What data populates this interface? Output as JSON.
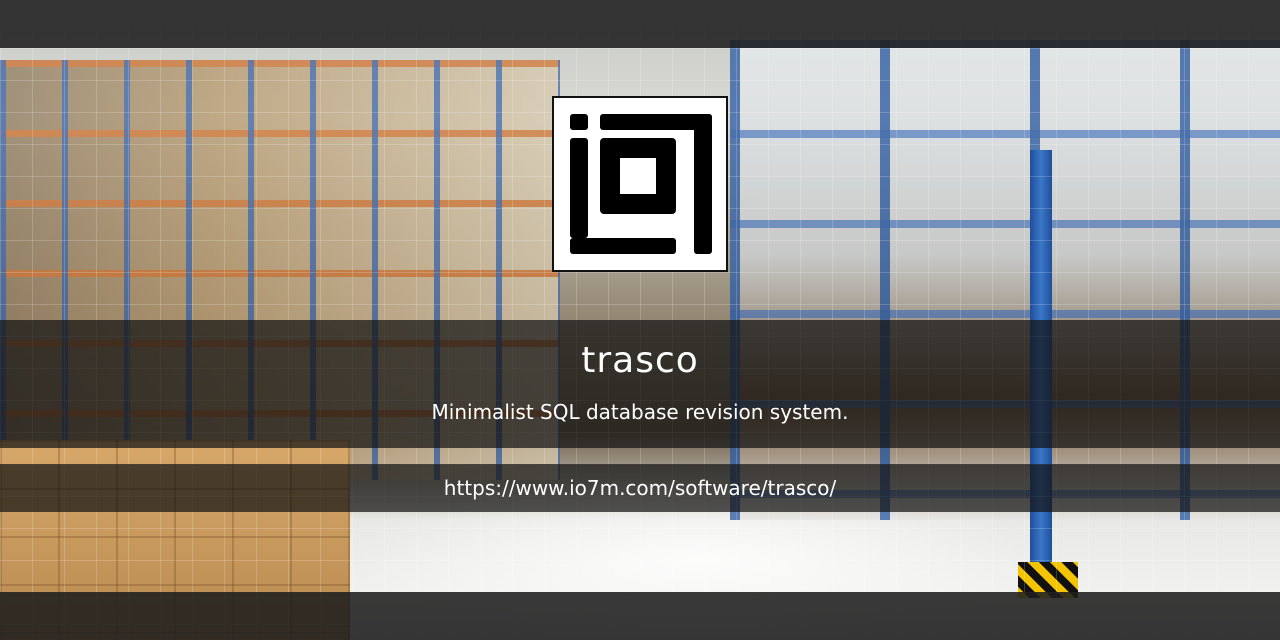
{
  "logo": {
    "icon": "io7-logo-icon"
  },
  "project": {
    "name": "trasco",
    "tagline": "Minimalist SQL database revision system.",
    "url": "https://www.io7m.com/software/trasco/"
  },
  "colors": {
    "text": "#ffffff",
    "band": "#141414",
    "logo_bg": "#ffffff",
    "logo_fg": "#000000"
  }
}
